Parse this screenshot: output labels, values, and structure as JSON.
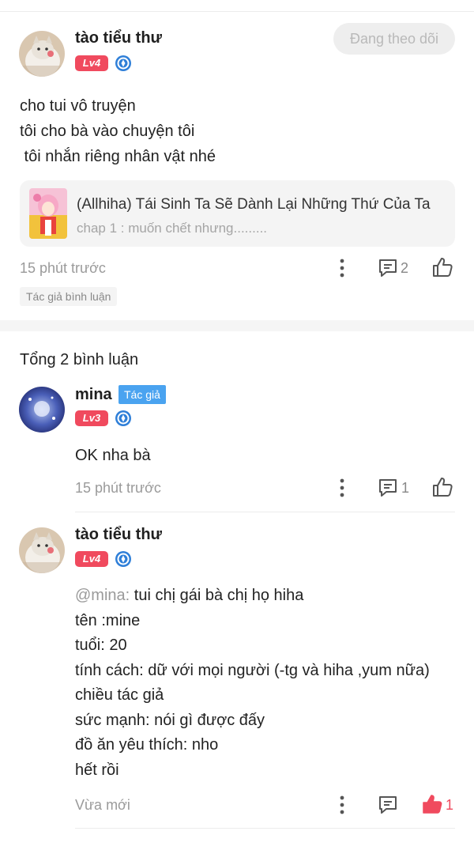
{
  "post": {
    "username": "tào tiểu thư",
    "level": "Lv4",
    "follow_label": "Đang theo dõi",
    "body": "cho tui vô truyện\ntôi cho bà vào chuyện tôi\n tôi nhắn riêng nhân vật nhé",
    "story": {
      "title": "(Allhiha) Tái Sinh Ta Sẽ Dành Lại Những Thứ Của Ta",
      "chapter": "chap 1 : muốn chết nhưng........."
    },
    "time": "15 phút trước",
    "comment_count": "2",
    "tag": "Tác giả bình luận"
  },
  "total_comments": "Tổng 2 bình luận",
  "comments": [
    {
      "username": "mina",
      "author_tag": "Tác giả",
      "level": "Lv3",
      "text": "OK nha bà",
      "time": "15 phút trước",
      "reply_count": "1"
    },
    {
      "username": "tào tiểu thư",
      "level": "Lv4",
      "mention": "@mina:",
      "text": " tui chị gái bà chị họ hiha\ntên :mine\ntuổi: 20\ntính cách: dữ với mọi người (-tg và hiha ,yum nữa)\nchiều tác giả\nsức mạnh: nói gì được đấy\nđồ ăn yêu thích: nho\nhết rồi",
      "time": "Vừa mới",
      "like_count": "1"
    }
  ],
  "colors": {
    "accent_red": "#f04a5e",
    "author_blue": "#4aa3f0",
    "muted": "#9a9a9a"
  }
}
